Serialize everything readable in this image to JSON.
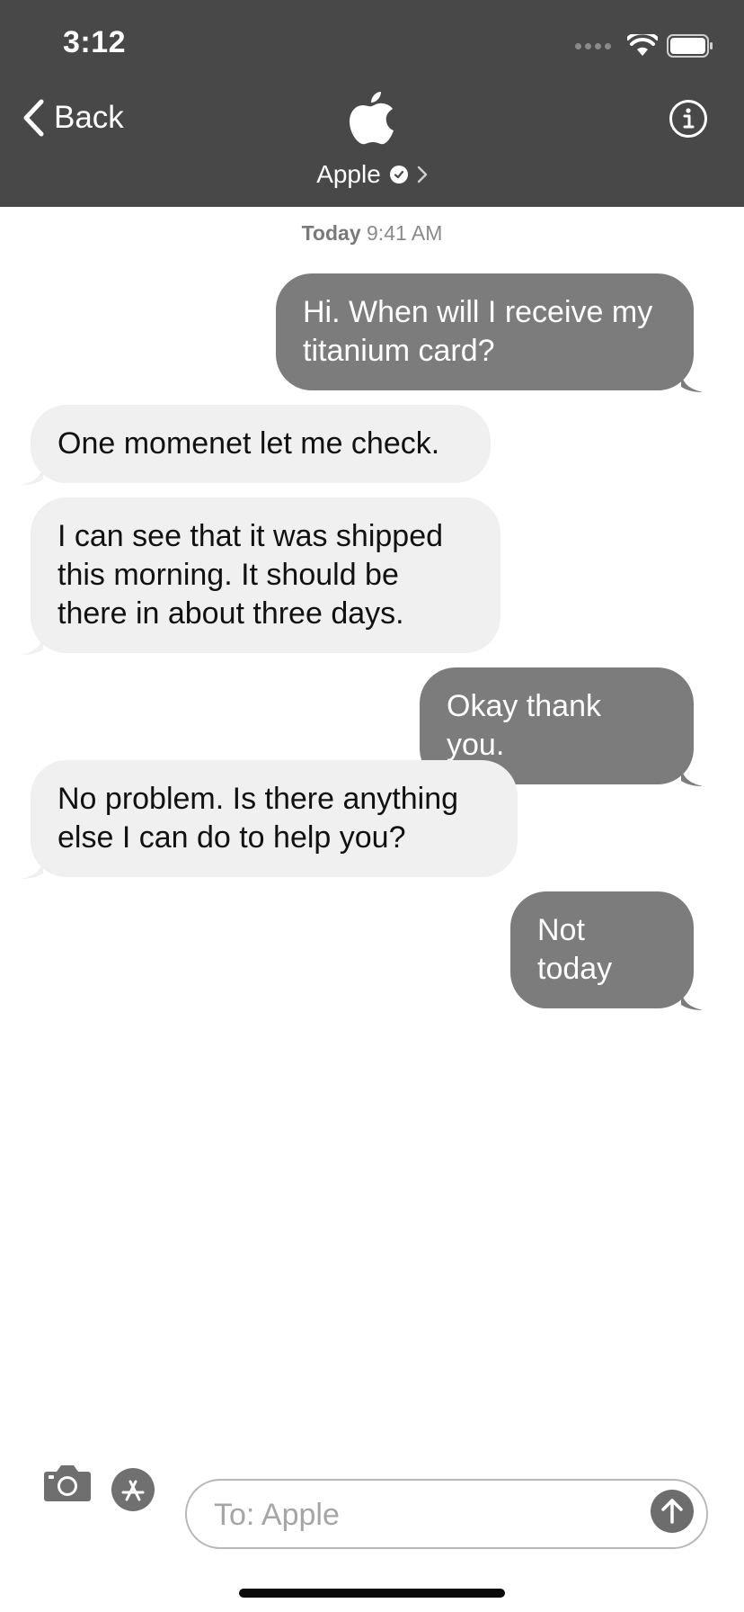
{
  "status_bar": {
    "time": "3:12"
  },
  "nav": {
    "back_label": "Back",
    "contact_name": "Apple",
    "brand_logo": "apple-logo",
    "info_icon": "info-icon"
  },
  "timestamp": {
    "day": "Today",
    "time": "9:41 AM"
  },
  "messages": [
    {
      "direction": "sent",
      "text": "Hi. When will I receive my titanium card?"
    },
    {
      "direction": "received",
      "text": "One momenet let me check."
    },
    {
      "direction": "received",
      "text": "I can see that it was shipped this morning. It should be there in about three days."
    },
    {
      "direction": "sent",
      "text": "Okay thank you."
    },
    {
      "direction": "received",
      "text": "No problem. Is there anything else I can do to help you?"
    },
    {
      "direction": "sent",
      "text": "Not today"
    }
  ],
  "composer": {
    "placeholder": "To: Apple",
    "value": "",
    "camera_icon": "camera-icon",
    "appstore_icon": "app-store-icon",
    "send_icon": "arrow-up-icon"
  },
  "colors": {
    "header_bg": "#484848",
    "sent_bubble": "#7c7c7c",
    "received_bubble": "#f0f0f0"
  }
}
